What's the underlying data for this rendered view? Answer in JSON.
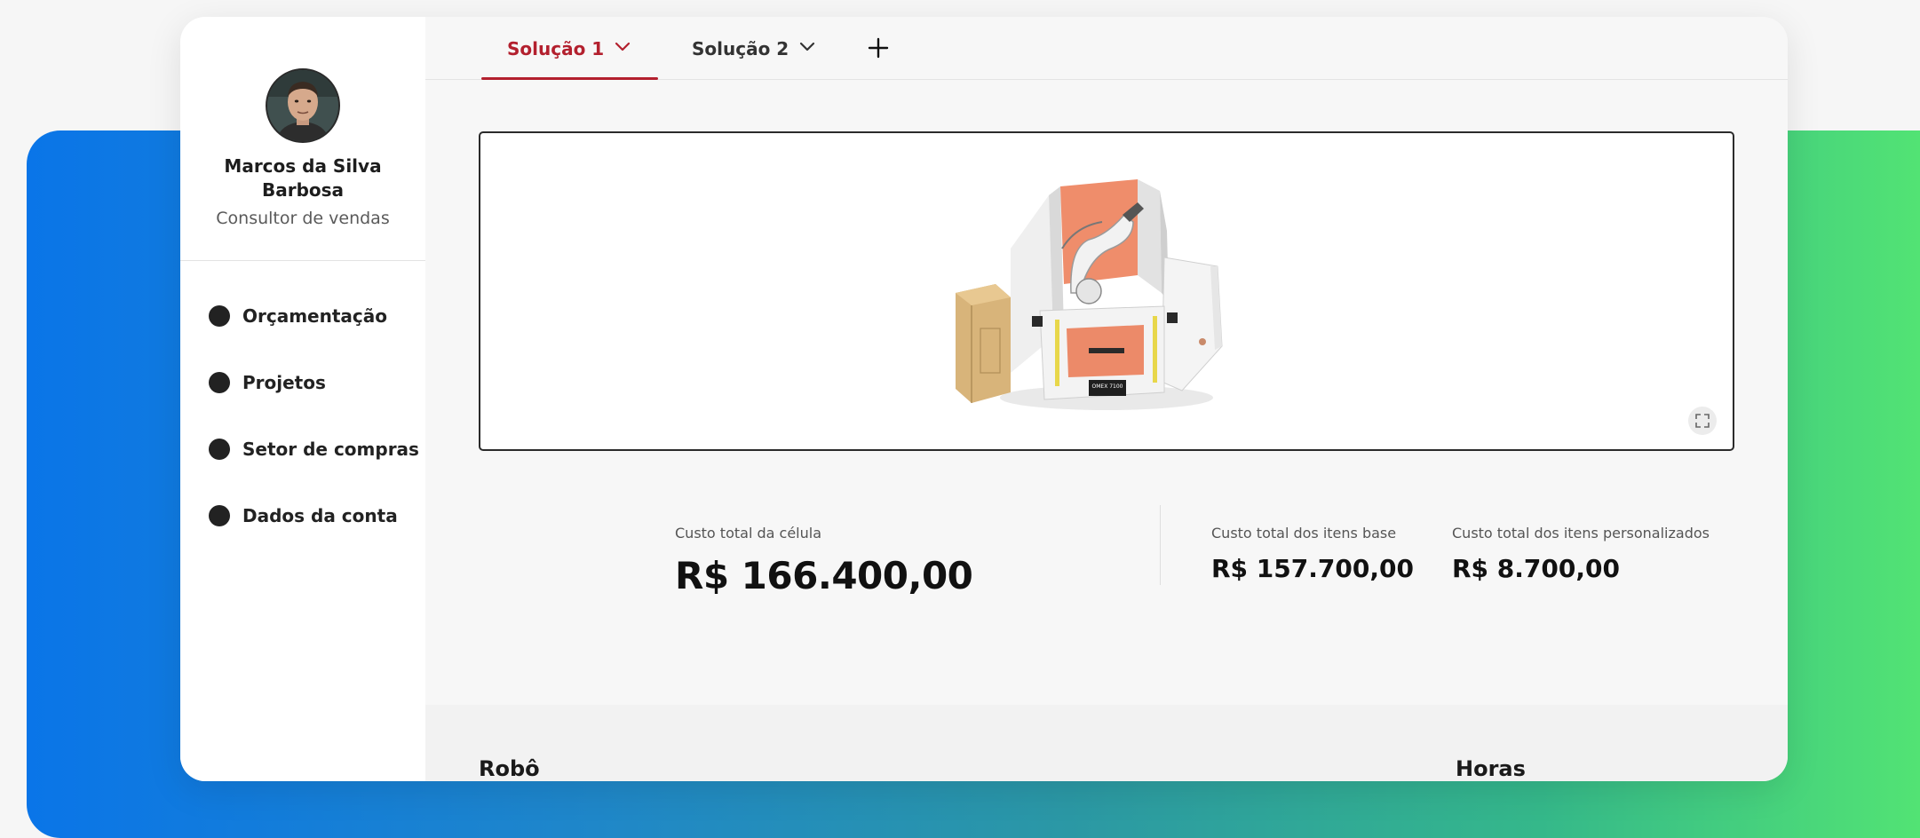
{
  "user": {
    "name": "Marcos da Silva Barbosa",
    "role": "Consultor de vendas"
  },
  "nav": {
    "items": [
      {
        "label": "Orçamentação"
      },
      {
        "label": "Projetos"
      },
      {
        "label": "Setor de compras"
      },
      {
        "label": "Dados da conta"
      }
    ]
  },
  "tabs": {
    "items": [
      {
        "label": "Solução 1",
        "active": true
      },
      {
        "label": "Solução 2",
        "active": false
      }
    ],
    "add_icon": "plus-icon"
  },
  "viewer": {
    "machine_label": "OMEX 7100",
    "expand_icon": "expand-icon"
  },
  "costs": {
    "total": {
      "label": "Custo total da célula",
      "value": "R$ 166.400,00"
    },
    "base": {
      "label": "Custo total dos itens base",
      "value": "R$ 157.700,00"
    },
    "custom": {
      "label": "Custo total dos itens personalizados",
      "value": "R$ 8.700,00"
    }
  },
  "sections": {
    "robot": "Robô",
    "hours": "Horas"
  },
  "colors": {
    "accent": "#b3202e",
    "gradient_start": "#0a75e8",
    "gradient_end": "#52e374"
  }
}
